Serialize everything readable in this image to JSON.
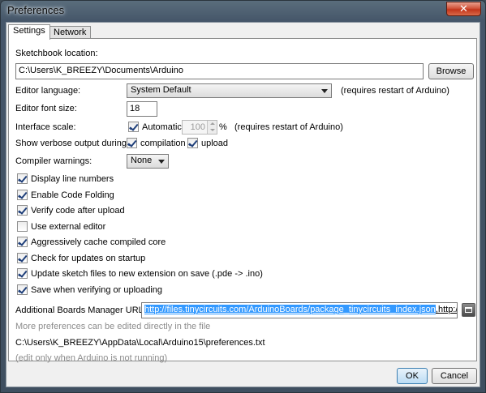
{
  "window": {
    "title": "Preferences",
    "close_glyph": "✕"
  },
  "tabs": [
    {
      "label": "Settings",
      "active": true
    },
    {
      "label": "Network",
      "active": false
    }
  ],
  "sketchbook": {
    "label": "Sketchbook location:",
    "value": "C:\\Users\\K_BREEZY\\Documents\\Arduino",
    "browse_label": "Browse"
  },
  "editor_language": {
    "label": "Editor language:",
    "selected": "System Default",
    "note": "(requires restart of Arduino)"
  },
  "editor_font_size": {
    "label": "Editor font size:",
    "value": "18"
  },
  "interface_scale": {
    "label": "Interface scale:",
    "automatic_label": "Automatic",
    "automatic_checked": true,
    "value": "100",
    "unit": "%",
    "note": "(requires restart of Arduino)"
  },
  "verbose": {
    "label": "Show verbose output during:",
    "compilation_label": "compilation",
    "compilation_checked": true,
    "upload_label": "upload",
    "upload_checked": true
  },
  "compiler_warnings": {
    "label": "Compiler warnings:",
    "selected": "None"
  },
  "options": [
    {
      "label": "Display line numbers",
      "checked": true
    },
    {
      "label": "Enable Code Folding",
      "checked": true
    },
    {
      "label": "Verify code after upload",
      "checked": true
    },
    {
      "label": "Use external editor",
      "checked": false
    },
    {
      "label": "Aggressively cache compiled core",
      "checked": true
    },
    {
      "label": "Check for updates on startup",
      "checked": true
    },
    {
      "label": "Update sketch files to new extension on save (.pde -> .ino)",
      "checked": true
    },
    {
      "label": "Save when verifying or uploading",
      "checked": true
    }
  ],
  "boards_manager": {
    "label": "Additional Boards Manager URLs:",
    "value_selected": "http://files.tinycircuits.com/ArduinoBoards/package_tinycircuits_index.json",
    "value_rest": ",http://drazz"
  },
  "footer_info": {
    "more_prefs": "More preferences can be edited directly in the file",
    "path": "C:\\Users\\K_BREEZY\\AppData\\Local\\Arduino15\\preferences.txt",
    "edit_note": "(edit only when Arduino is not running)"
  },
  "buttons": {
    "ok": "OK",
    "cancel": "Cancel"
  },
  "icons": {
    "close": "close-icon",
    "window_edit": "window-icon",
    "dropdown": "chevron-down-icon",
    "check": "check-icon"
  },
  "colors": {
    "selection": "#3399ff",
    "titlebar": "#46576a",
    "close_button": "#c3351b"
  }
}
